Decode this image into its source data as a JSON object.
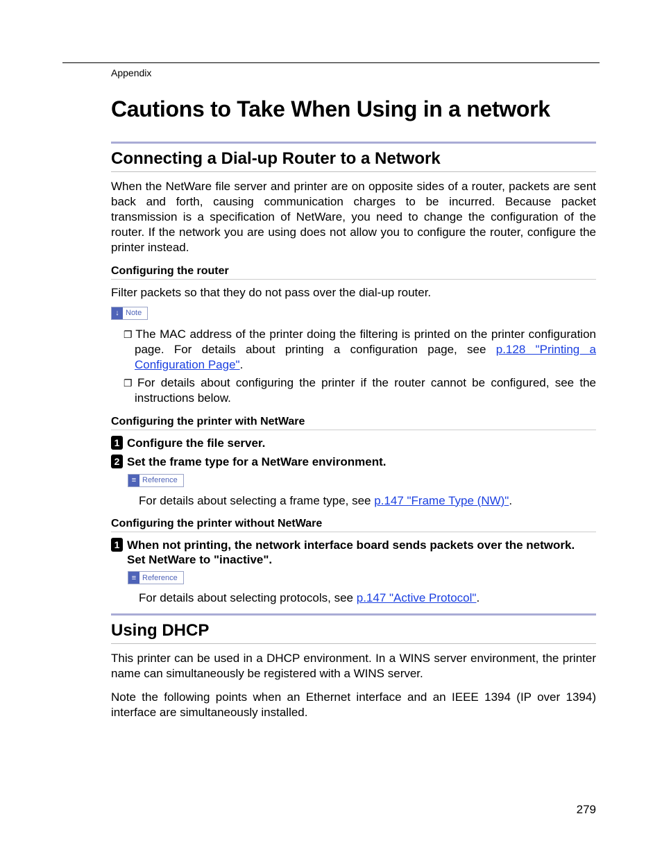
{
  "breadcrumb": "Appendix",
  "title": "Cautions to Take When Using in a network",
  "page_number": "279",
  "section1": {
    "heading": "Connecting a Dial-up Router to a Network",
    "intro": "When the NetWare file server and printer are on opposite sides of a router, packets are sent back and forth, causing communication charges to be incurred. Because packet transmission is a specification of NetWare, you need to change the configuration of the router. If the network you are using does not allow you to configure the router, configure the printer instead.",
    "sub1": {
      "heading": "Configuring the router",
      "body": "Filter packets so that they do not pass over the dial-up router.",
      "note_label": "Note",
      "note1_pre": "The MAC address of the printer doing the filtering is printed on the printer configuration page. For details about printing a configuration page, see ",
      "note1_link": "p.128 \"Printing a Configuration Page\"",
      "note1_post": ".",
      "note2": "For details about configuring the printer if the router cannot be configured, see the instructions below."
    },
    "sub2": {
      "heading": "Configuring the printer with NetWare",
      "step1": "Configure the file server.",
      "step2": "Set the frame type for a NetWare environment.",
      "reference_label": "Reference",
      "ref_text_pre": "For details about selecting a frame type, see ",
      "ref_link": "p.147 \"Frame Type (NW)\"",
      "ref_text_post": "."
    },
    "sub3": {
      "heading": "Configuring the printer without NetWare",
      "step1": "When not printing, the network interface board sends packets over the network. Set NetWare to \"inactive\".",
      "reference_label": "Reference",
      "ref_text_pre": "For details about selecting protocols, see ",
      "ref_link": "p.147 \"Active Protocol\"",
      "ref_text_post": "."
    }
  },
  "section2": {
    "heading": "Using DHCP",
    "p1": "This printer can be used in a DHCP environment. In a WINS server environment, the printer name can simultaneously be registered with a WINS server.",
    "p2": "Note the following points when an Ethernet interface and an IEEE 1394 (IP over 1394) interface are simultaneously installed."
  }
}
